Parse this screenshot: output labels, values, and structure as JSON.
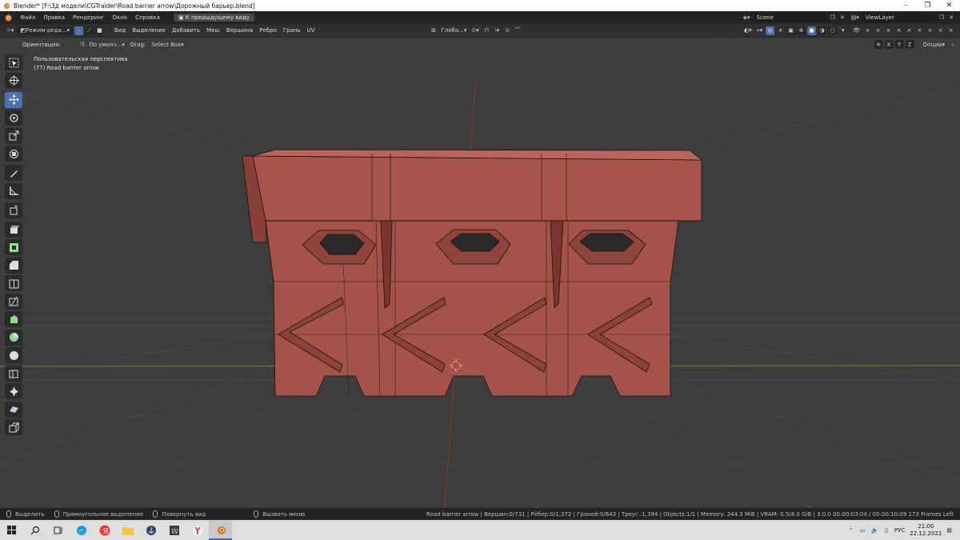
{
  "titlebar": {
    "title": "Blender* [F:\\3д модели\\CGTraider\\Road barrier arrow\\Дорожный барьер.blend]",
    "minimize": "–",
    "maximize": "❐",
    "close": "✕"
  },
  "menubar": {
    "items": [
      "Файл",
      "Правка",
      "Рендеринг",
      "Окно",
      "Справка"
    ],
    "back_button": "К предыдущему виду",
    "scene": "Scene",
    "view_layer": "ViewLayer"
  },
  "header": {
    "mode": "Режим реда...",
    "menus": [
      "Вид",
      "Выделение",
      "Добавить",
      "Меш",
      "Вершина",
      "Ребро",
      "Грань",
      "UV"
    ],
    "transform_orientation": "Глоба...",
    "axes": [
      "X",
      "Y",
      "Z"
    ]
  },
  "subheader": {
    "orientation_label": "Ориентация:",
    "pivot": "По умолч...",
    "drag_label": "Drag:",
    "drag_value": "Select Box",
    "options": "Опции"
  },
  "viewport": {
    "perspective_label": "Пользовательская перспектива",
    "object_label": "(77) Road barrier arrow"
  },
  "toolbar": {
    "tools": [
      "select-box",
      "cursor",
      "move",
      "rotate",
      "scale",
      "transform",
      "annotate",
      "measure",
      "add-cube",
      "extrude",
      "inset",
      "bevel",
      "loop-cut",
      "knife",
      "poly-build",
      "spin",
      "smooth",
      "edge-slide",
      "shrink-fatten",
      "shear",
      "rip"
    ]
  },
  "statusbar": {
    "select": "Выделить",
    "box_select": "Прямоугольное выделение",
    "rotate_view": "Повернуть вид",
    "call_menu": "Вызвать меню",
    "stats": "Road barrier arrow | Вершин:0/731 | Рёбер:0/1,372 | Граней:0/643 | Треуг.:1,394 | Objects:1/1 | Memory: 244.3 MiB | VRAM: 0.5/4.0 GiB | 3.0.0   00:00:03:04 / 00:00:10:09  173 Frames Left"
  },
  "taskbar": {
    "language": "РУС",
    "time": "21:00",
    "date": "22.12.2021"
  },
  "colors": {
    "viewport_bg": "#3d3d3d",
    "accent_blue": "#4772b3",
    "model_red": "#a8554c",
    "x_axis": "#8a3a3a",
    "y_axis": "#6c8a2a"
  }
}
